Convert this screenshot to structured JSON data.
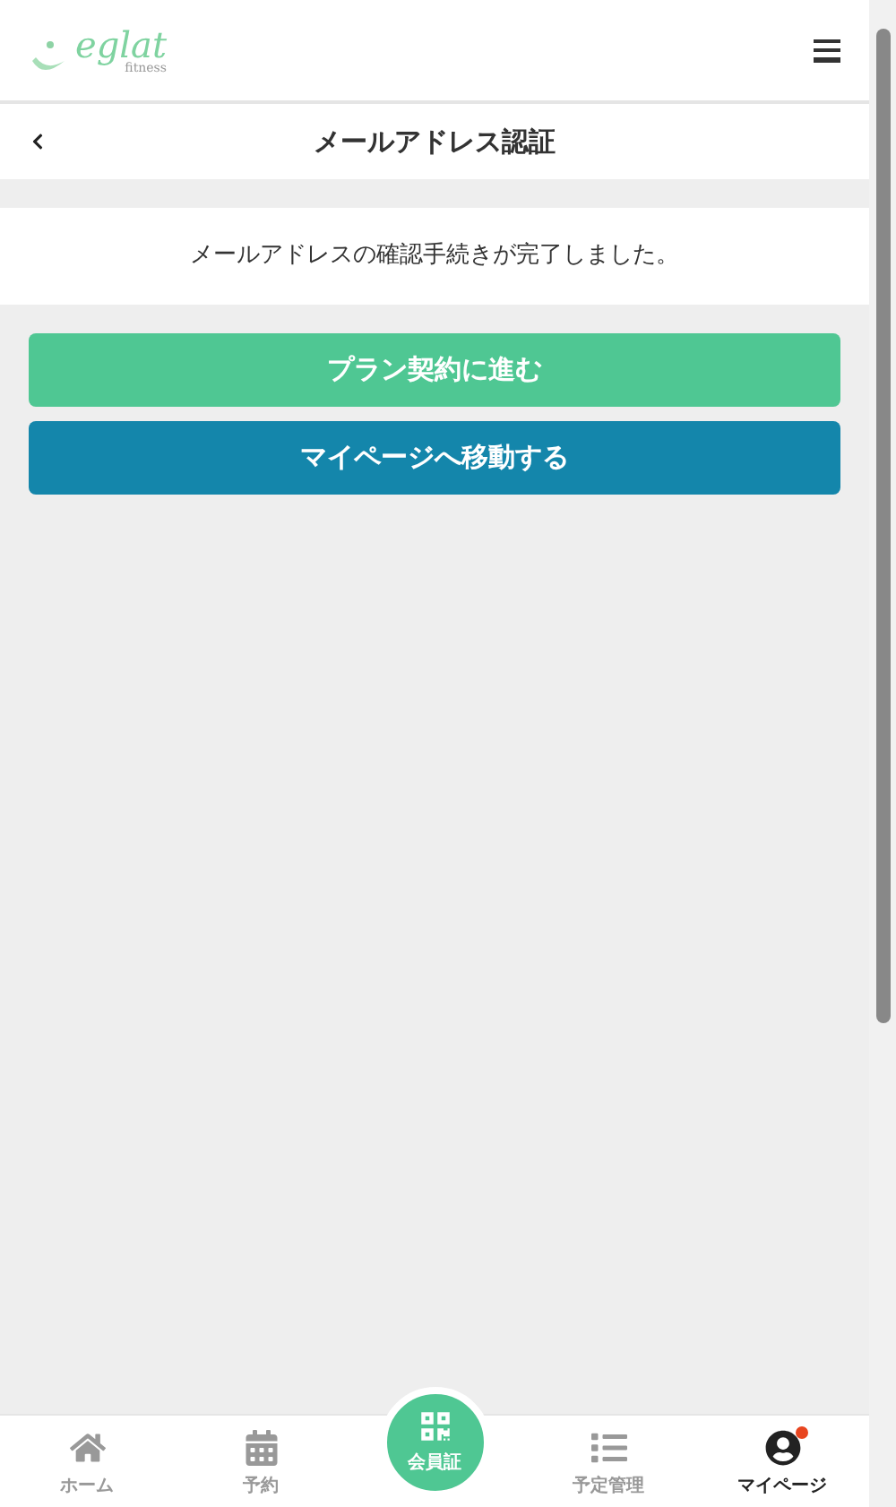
{
  "header": {
    "logo": {
      "name": "eglat",
      "tagline": "fitness"
    }
  },
  "title_bar": {
    "title": "メールアドレス認証"
  },
  "message": "メールアドレスの確認手続きが完了しました。",
  "buttons": [
    {
      "label": "プラン契約に進む",
      "color": "#4fc793"
    },
    {
      "label": "マイページへ移動する",
      "color": "#1486ab"
    }
  ],
  "bottom_nav": [
    {
      "label": "ホーム",
      "kind": "home",
      "selected": false,
      "badge": false
    },
    {
      "label": "予約",
      "kind": "calendar",
      "selected": false,
      "badge": false
    },
    {
      "label": "会員証",
      "kind": "card",
      "selected": false,
      "badge": false
    },
    {
      "label": "予定管理",
      "kind": "list",
      "selected": false,
      "badge": false
    },
    {
      "label": "マイページ",
      "kind": "user",
      "selected": true,
      "badge": true
    }
  ]
}
